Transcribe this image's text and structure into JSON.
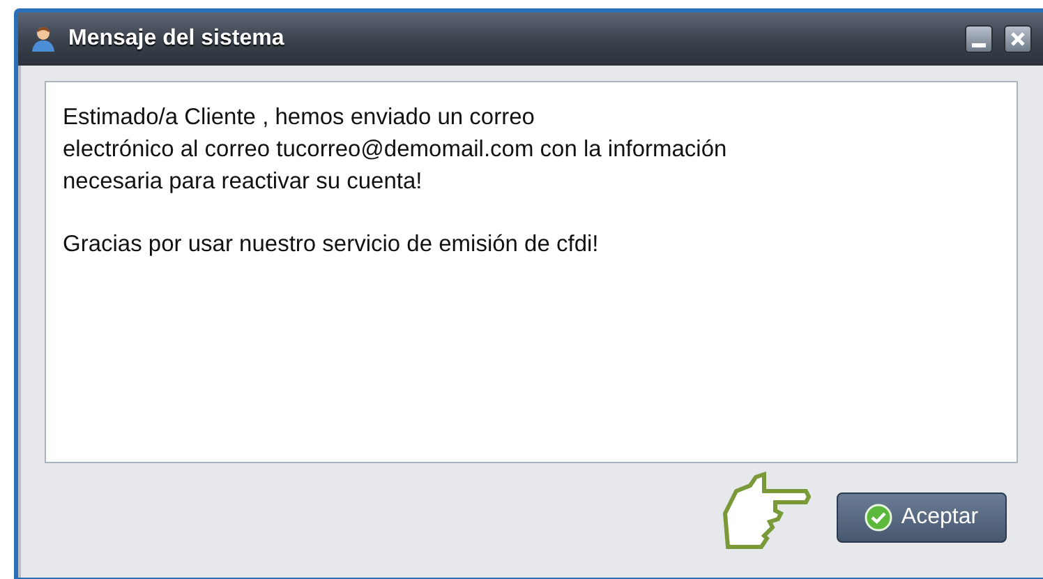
{
  "window": {
    "title": "Mensaje del sistema"
  },
  "message": {
    "paragraphs": [
      [
        "Estimado/a Cliente , hemos enviado un correo",
        "electrónico al correo tucorreo@demomail.com  con la información",
        "necesaria para reactivar su cuenta!"
      ],
      [
        "Gracias por usar nuestro servicio de emisión de cfdi!"
      ]
    ]
  },
  "buttons": [
    {
      "label": "Aceptar"
    }
  ]
}
